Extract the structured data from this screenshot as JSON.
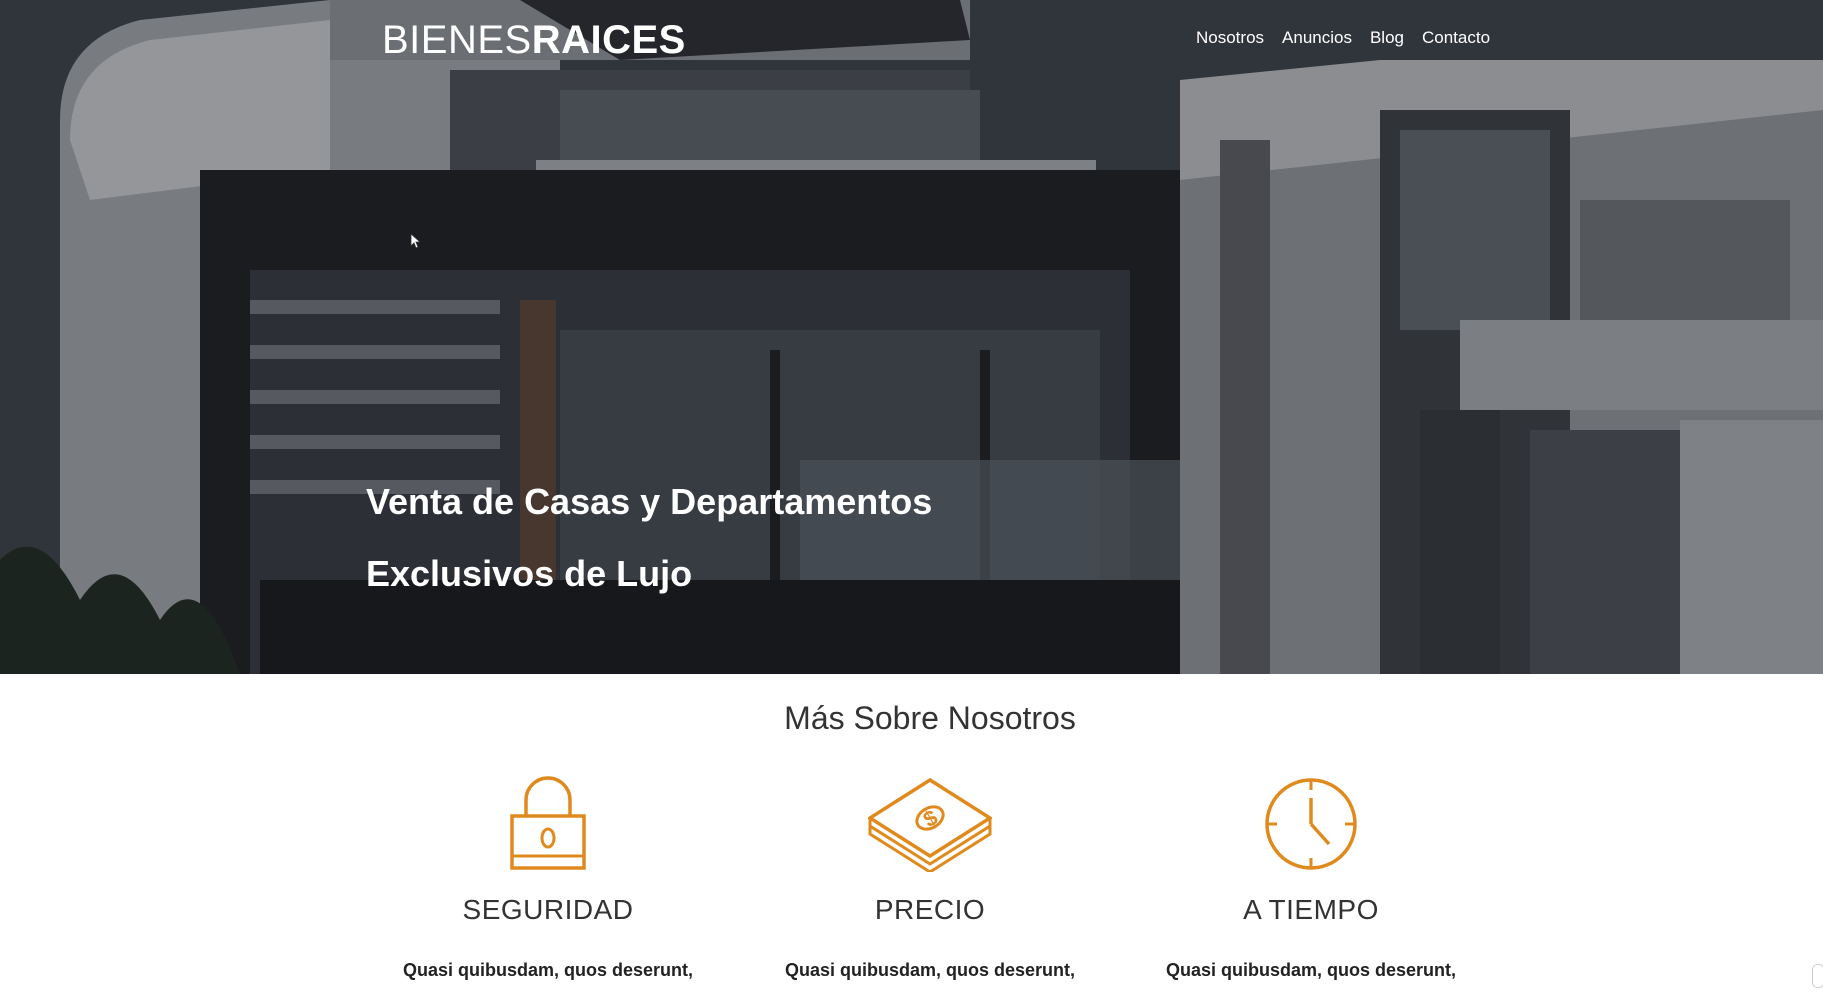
{
  "header": {
    "logo": {
      "light": "BIENES",
      "bold": "RAICES"
    },
    "nav": [
      "Nosotros",
      "Anuncios",
      "Blog",
      "Contacto"
    ]
  },
  "hero": {
    "title": "Venta de Casas y Departamentos Exclusivos de Lujo"
  },
  "about": {
    "title": "Más Sobre Nosotros",
    "features": [
      {
        "icon": "lock-icon",
        "title": "SEGURIDAD",
        "text": "Quasi quibusdam, quos deserunt,"
      },
      {
        "icon": "money-icon",
        "title": "PRECIO",
        "text": "Quasi quibusdam, quos deserunt,"
      },
      {
        "icon": "clock-icon",
        "title": "A TIEMPO",
        "text": "Quasi quibusdam, quos deserunt,"
      }
    ]
  },
  "colors": {
    "accent": "#e08a1e",
    "text": "#333333",
    "nav_text": "#ffffff"
  }
}
